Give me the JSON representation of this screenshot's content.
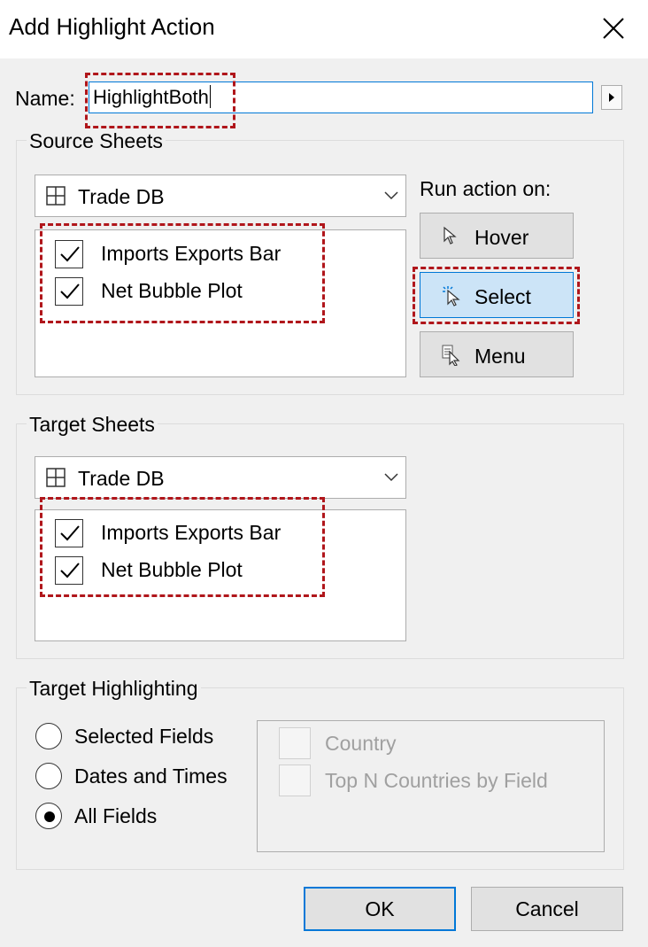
{
  "window": {
    "title": "Add Highlight Action",
    "close_icon": "close-icon"
  },
  "name_field": {
    "label": "Name:",
    "value": "HighlightBoth"
  },
  "source": {
    "legend": "Source Sheets",
    "dashboard": "Trade DB",
    "sheets": [
      {
        "label": "Imports Exports Bar",
        "checked": true
      },
      {
        "label": "Net Bubble Plot",
        "checked": true
      }
    ]
  },
  "run_action": {
    "label": "Run action on:",
    "buttons": [
      {
        "label": "Hover",
        "icon": "pointer-icon",
        "active": false
      },
      {
        "label": "Select",
        "icon": "click-pointer-icon",
        "active": true
      },
      {
        "label": "Menu",
        "icon": "menu-pointer-icon",
        "active": false
      }
    ]
  },
  "target": {
    "legend": "Target Sheets",
    "dashboard": "Trade DB",
    "sheets": [
      {
        "label": "Imports Exports Bar",
        "checked": true
      },
      {
        "label": "Net Bubble Plot",
        "checked": true
      }
    ]
  },
  "highlighting": {
    "legend": "Target Highlighting",
    "options": [
      {
        "label": "Selected Fields",
        "selected": false
      },
      {
        "label": "Dates and Times",
        "selected": false
      },
      {
        "label": "All Fields",
        "selected": true
      }
    ],
    "fields": [
      {
        "label": "Country",
        "enabled": false
      },
      {
        "label": "Top N Countries by Field",
        "enabled": false
      }
    ]
  },
  "footer": {
    "ok": "OK",
    "cancel": "Cancel"
  },
  "colors": {
    "accent": "#0078d7",
    "annotation": "#b0161b",
    "active_button": "#cce4f7"
  }
}
